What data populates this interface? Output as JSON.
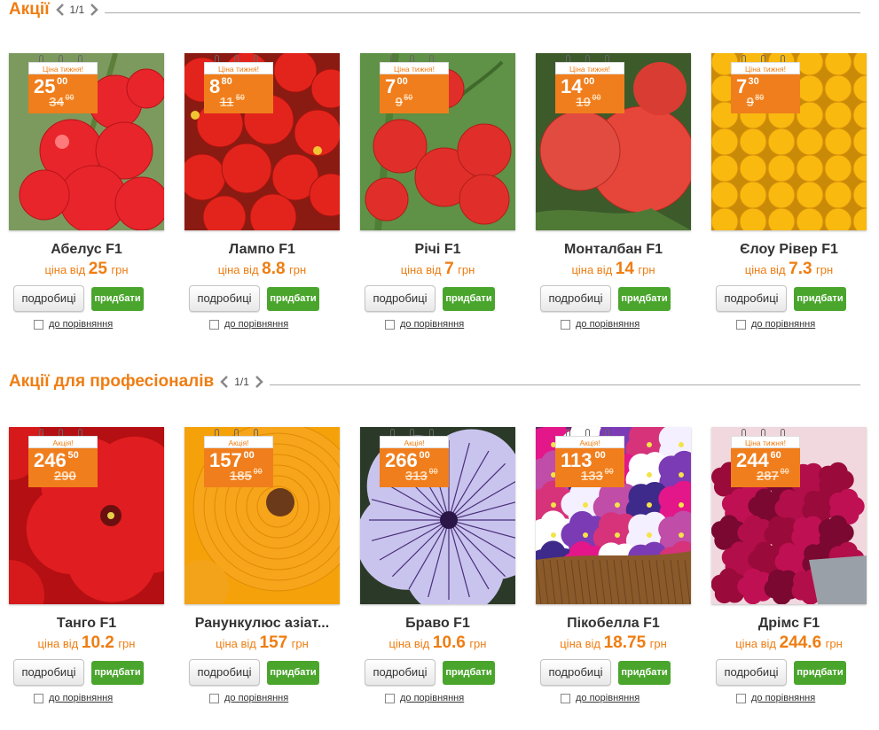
{
  "sections": [
    {
      "title": "Акції",
      "page_count": "1/1",
      "products": [
        {
          "name": "Абелус F1",
          "price_prefix": "ціна від",
          "price": "25",
          "currency": "грн",
          "tag_label": "Ціна тижня!",
          "tag_price": "25",
          "tag_cents": "00",
          "tag_old": "34",
          "tag_old_cents": "00",
          "photo": "tomato-red-cluster"
        },
        {
          "name": "Лампо F1",
          "price_prefix": "ціна від",
          "price": "8.8",
          "currency": "грн",
          "tag_label": "Ціна тижня!",
          "tag_price": "8",
          "tag_cents": "80",
          "tag_old": "11",
          "tag_old_cents": "50",
          "photo": "tomato-red-pile"
        },
        {
          "name": "Річі F1",
          "price_prefix": "ціна від",
          "price": "7",
          "currency": "грн",
          "tag_label": "Ціна тижня!",
          "tag_price": "7",
          "tag_cents": "00",
          "tag_old": "9",
          "tag_old_cents": "50",
          "photo": "tomato-red-vine"
        },
        {
          "name": "Монталбан F1",
          "price_prefix": "ціна від",
          "price": "14",
          "currency": "грн",
          "tag_label": "Ціна тижня!",
          "tag_price": "14",
          "tag_cents": "00",
          "tag_old": "19",
          "tag_old_cents": "00",
          "photo": "tomato-pink-big"
        },
        {
          "name": "Єлоу Рівер F1",
          "price_prefix": "ціна від",
          "price": "7.3",
          "currency": "грн",
          "tag_label": "Ціна тижня!",
          "tag_price": "7",
          "tag_cents": "30",
          "tag_old": "9",
          "tag_old_cents": "80",
          "photo": "tomato-yellow"
        }
      ]
    },
    {
      "title": "Акції для професіоналів",
      "page_count": "1/1",
      "products": [
        {
          "name": "Танго F1",
          "price_prefix": "ціна від",
          "price": "10.2",
          "currency": "грн",
          "tag_label": "Акція!",
          "tag_price": "246",
          "tag_cents": "50",
          "tag_old": "290",
          "tag_old_cents": "",
          "photo": "petunia-red"
        },
        {
          "name": "Ранункулюс азіат...",
          "price_prefix": "ціна від",
          "price": "157",
          "currency": "грн",
          "tag_label": "Акція!",
          "tag_price": "157",
          "tag_cents": "00",
          "tag_old": "185",
          "tag_old_cents": "00",
          "photo": "ranunculus-orange"
        },
        {
          "name": "Браво F1",
          "price_prefix": "ціна від",
          "price": "10.6",
          "currency": "грн",
          "tag_label": "Акція!",
          "tag_price": "266",
          "tag_cents": "00",
          "tag_old": "313",
          "tag_old_cents": "00",
          "photo": "petunia-veined"
        },
        {
          "name": "Пікобелла F1",
          "price_prefix": "ціна від",
          "price": "18.75",
          "currency": "грн",
          "tag_label": "Акція!",
          "tag_price": "113",
          "tag_cents": "00",
          "tag_old": "133",
          "tag_old_cents": "00",
          "photo": "petunia-mix"
        },
        {
          "name": "Дрімс F1",
          "price_prefix": "ціна від",
          "price": "244.6",
          "currency": "грн",
          "tag_label": "Ціна тижня!",
          "tag_price": "244",
          "tag_cents": "60",
          "tag_old": "287",
          "tag_old_cents": "00",
          "photo": "petunia-burgundy"
        }
      ]
    }
  ],
  "labels": {
    "details": "подробиці",
    "buy": "придбати",
    "compare": "до порівняння"
  },
  "icons": {
    "prev": "chevron-left-icon",
    "next": "chevron-right-icon"
  },
  "colors": {
    "accent": "#ef7d12",
    "buy": "#4aa52d",
    "tag": "#f07e1c"
  }
}
